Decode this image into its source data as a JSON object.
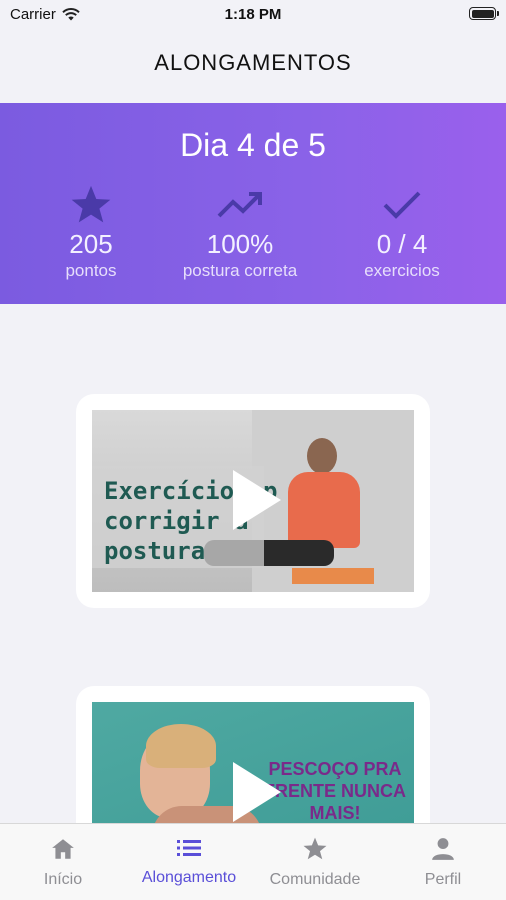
{
  "status_bar": {
    "carrier": "Carrier",
    "time": "1:18 PM"
  },
  "header": {
    "title": "ALONGAMENTOS"
  },
  "hero": {
    "day_label": "Dia 4 de 5",
    "stats": [
      {
        "icon": "star-icon",
        "value": "205",
        "label": "pontos"
      },
      {
        "icon": "trending-up-icon",
        "value": "100%",
        "label": "postura correta"
      },
      {
        "icon": "check-icon",
        "value": "0 / 4",
        "label": "exercicios"
      }
    ]
  },
  "videos": [
    {
      "thumbnail_text": "Exercícios p\ncorrigir a\npostura"
    },
    {
      "thumbnail_text": "PESCOÇO PRA FRENTE NUNCA MAIS!"
    }
  ],
  "tabs": [
    {
      "label": "Início",
      "icon": "home-icon",
      "active": false
    },
    {
      "label": "Alongamento",
      "icon": "list-icon",
      "active": true
    },
    {
      "label": "Comunidade",
      "icon": "star-icon",
      "active": false
    },
    {
      "label": "Perfil",
      "icon": "person-icon",
      "active": false
    }
  ],
  "colors": {
    "accent": "#7b5be0",
    "accent_end": "#9a60ec",
    "tab_active": "#5a4fd8",
    "tab_inactive": "#8e8e93"
  }
}
